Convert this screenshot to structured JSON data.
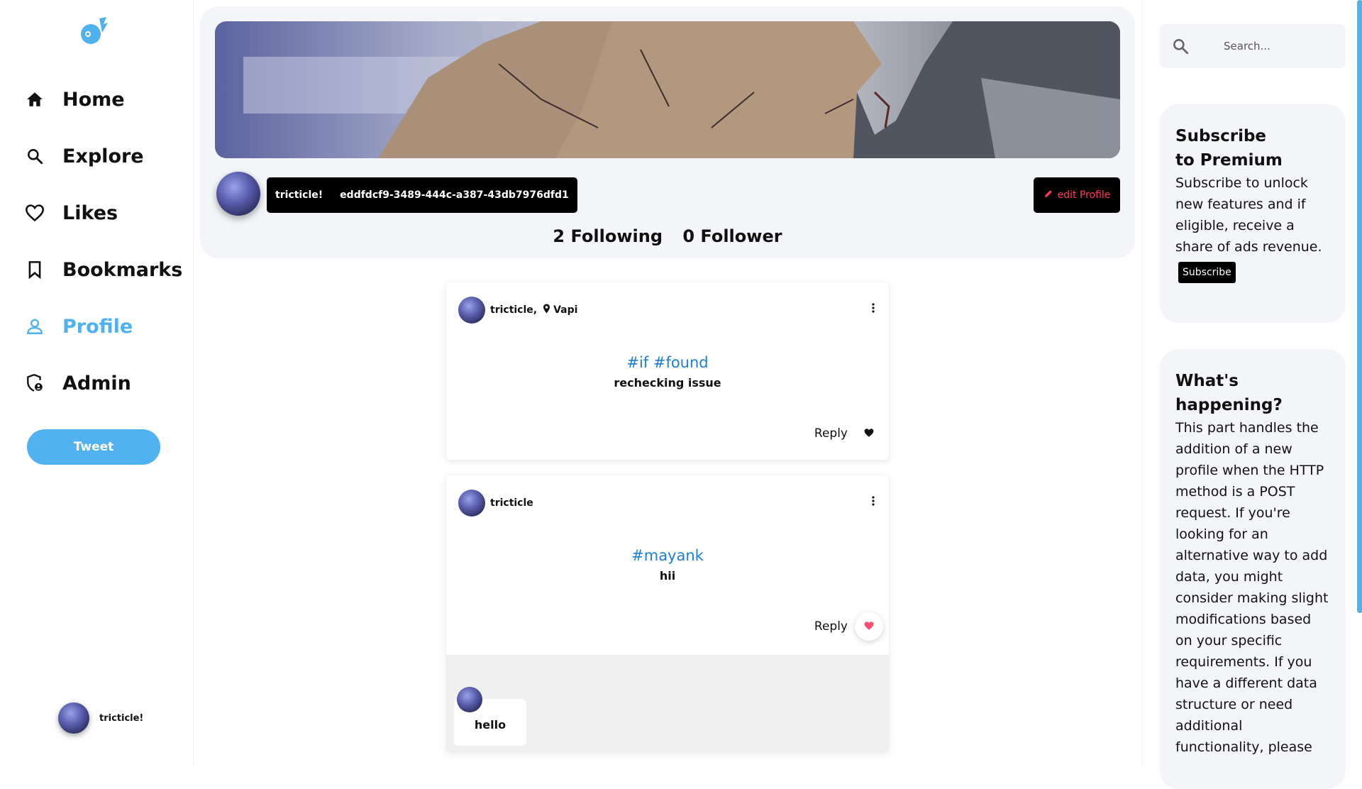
{
  "sidebar": {
    "logo_icon": "meteor-logo-icon",
    "items": [
      {
        "label": "Home",
        "icon": "home-icon"
      },
      {
        "label": "Explore",
        "icon": "search-icon"
      },
      {
        "label": "Likes",
        "icon": "heart-icon"
      },
      {
        "label": "Bookmarks",
        "icon": "bookmark-icon"
      },
      {
        "label": "Profile",
        "icon": "user-icon",
        "active": true
      },
      {
        "label": "Admin",
        "icon": "admin-shield-icon"
      }
    ],
    "tweet_label": "Tweet",
    "account_name": "tricticle!"
  },
  "profile": {
    "name": "tricticle!",
    "id": "eddfdcf9-3489-444c-a387-43db7976dfd1",
    "edit_label": "edit Profile",
    "following": "2 Following",
    "followers": "0 Follower"
  },
  "posts": [
    {
      "author": "tricticle",
      "separator": ",",
      "location": "Vapi",
      "tags": "#if #found",
      "text": "rechecking issue",
      "reply_label": "Reply",
      "liked": false
    },
    {
      "author": "tricticle",
      "location": "",
      "tags": "#mayank",
      "text": "hii",
      "reply_label": "Reply",
      "liked": true,
      "comments": [
        {
          "text": "hello"
        }
      ]
    }
  ],
  "search": {
    "placeholder": "Search..."
  },
  "premium": {
    "title_line1": "Subscribe",
    "title_line2": "to Premium",
    "body": "Subscribe to unlock new features and if eligible, receive a share of ads revenue.",
    "button": "Subscribe"
  },
  "happening": {
    "title_line1": "What's",
    "title_line2": "happening?",
    "body": "This part handles the addition of a new profile when the HTTP method is a POST request. If you're looking for an alternative way to add data, you might consider making slight modifications based on your specific requirements. If you have a different data structure or need additional functionality, please"
  },
  "colors": {
    "accent": "#4fb2ef",
    "edit": "#ff3b5c",
    "like": "#ff4d6d",
    "tag": "#1d7fd4"
  }
}
